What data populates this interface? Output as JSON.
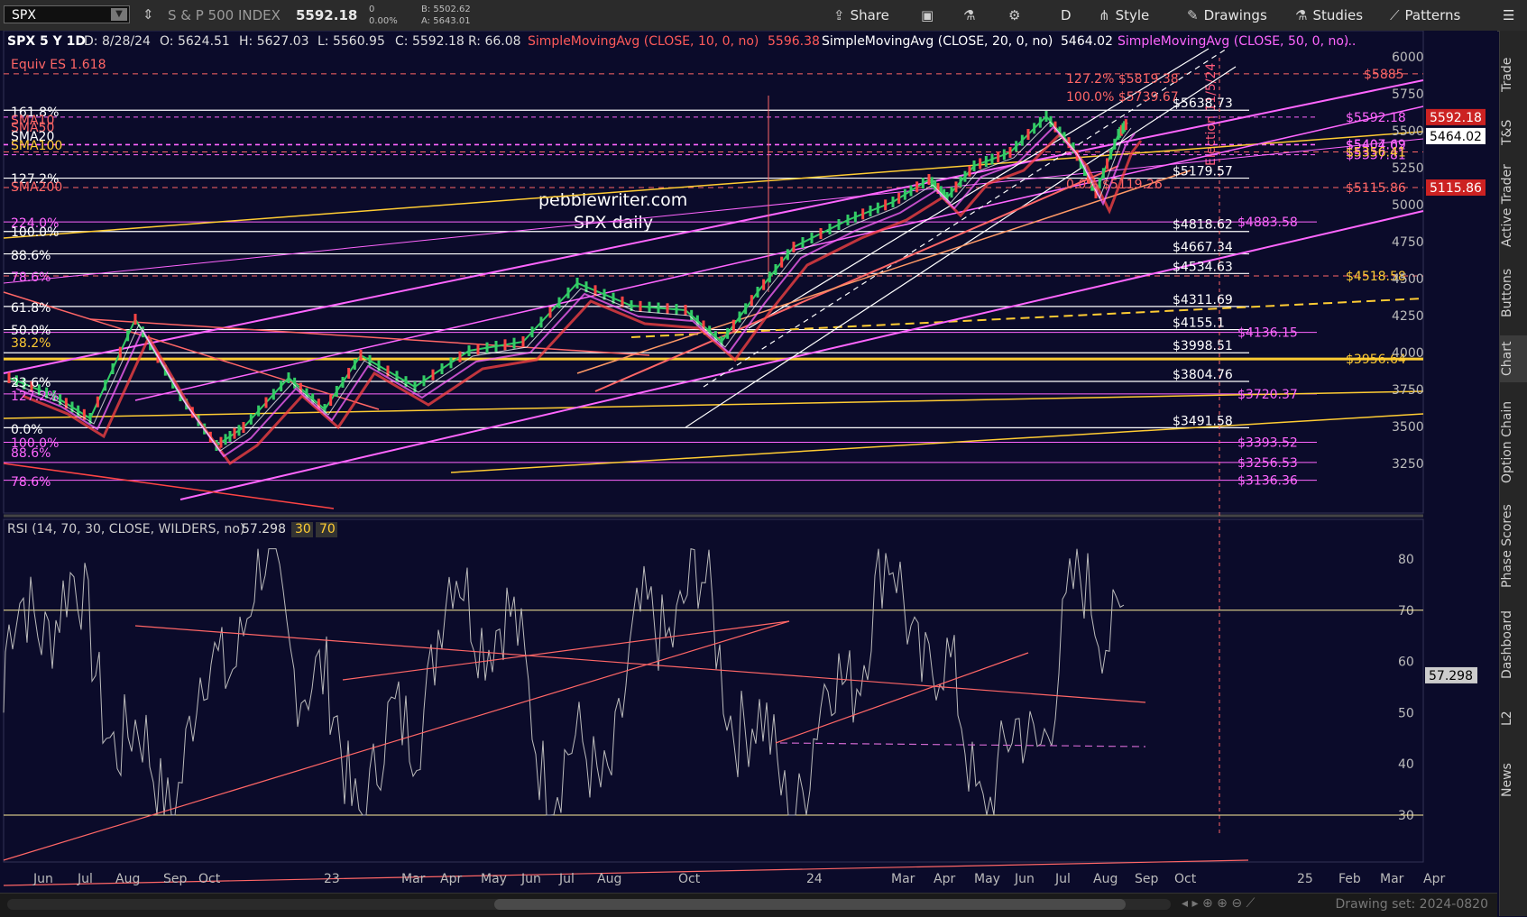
{
  "toolbar": {
    "symbol": "SPX",
    "name": "S & P 500 INDEX",
    "price": "5592.18",
    "chg": "0",
    "chg_pct": "0.00%",
    "bid": "B: 5502.62",
    "ask": "A: 5643.01",
    "share": "Share",
    "period": "D",
    "style": "Style",
    "drawings": "Drawings",
    "studies": "Studies",
    "patterns": "Patterns"
  },
  "header": {
    "title": "SPX 5 Y 1D",
    "date": "D: 8/28/24",
    "open": "O: 5624.51",
    "high": "H: 5627.03",
    "low": "L: 5560.95",
    "close": "C: 5592.18",
    "range": "R: 66.08",
    "sma10": "SimpleMovingAvg (CLOSE, 10, 0, no)",
    "sma10_val": "5596.38",
    "sma20": "SimpleMovingAvg (CLOSE, 20, 0, no)",
    "sma20_val": "5464.02",
    "sma50": "SimpleMovingAvg (CLOSE, 50, 0, no)",
    "more": "..."
  },
  "annotations": {
    "equiv": "Equiv ES 1.618",
    "site": "pebblewriter.com",
    "subtitle": "SPX daily",
    "election": "Election 11/5/24"
  },
  "fib_left": [
    "161.8%",
    "SMA10",
    "SMA50",
    "SMA20",
    "SMA100",
    "127.2%",
    "SMA200",
    "224.0%",
    "100.0%",
    "88.6%",
    "78.6%",
    "61.8%",
    "50.0%",
    "38.2%",
    "23.6%",
    "127.2%",
    "0.0%",
    "100.0%",
    "88.6%",
    "78.6%"
  ],
  "levels_white": [
    "$5638.73",
    "$5179.57",
    "$4818.62",
    "$4667.34",
    "$4534.63",
    "$4311.69",
    "$4155.1",
    "$3998.51",
    "$3804.76",
    "$3491.58"
  ],
  "levels_pink": [
    "$5592.18",
    "$5407.69",
    "$5404.02",
    "$5337.81",
    "$4883.58",
    "$4136.15",
    "$3720.37",
    "$3393.52",
    "$3256.53",
    "$3136.36"
  ],
  "levels_orange": [
    "$5885",
    "$5356.41",
    "$5115.86",
    "$4518.58",
    "$3956.64"
  ],
  "upper_fibs": [
    "127.2% $5819.38",
    "100.0% $5739.67",
    "0.0% $5119.26"
  ],
  "price_axis": [
    "6000",
    "5750",
    "5500",
    "5250",
    "5000",
    "4750",
    "4500",
    "4250",
    "4000",
    "3750",
    "3500",
    "3250"
  ],
  "price_badges": {
    "close": "5592.18",
    "sma20": "5464.02",
    "sma50": "5115.86"
  },
  "rsi": {
    "label": "RSI (14, 70, 30, CLOSE, WILDERS, no)",
    "value": "57.298",
    "ob": "70",
    "os": "30",
    "axis": [
      "80",
      "70",
      "60",
      "50",
      "40",
      "30"
    ]
  },
  "x_axis": [
    "Jun",
    "Jul",
    "Aug",
    "Sep",
    "Oct",
    "23",
    "Mar",
    "Apr",
    "May",
    "Jun",
    "Jul",
    "Aug",
    "Oct",
    "24",
    "Mar",
    "Apr",
    "May",
    "Jun",
    "Jul",
    "Aug",
    "Sep",
    "Oct",
    "25",
    "Feb",
    "Mar",
    "Apr"
  ],
  "right_nav": [
    "Trade",
    "T&S",
    "Active Trader",
    "Buttons",
    "Chart",
    "Option Chain",
    "Phase Scores",
    "Dashboard",
    "L2",
    "News"
  ],
  "status": {
    "drawing_set": "Drawing set: 2024-0820"
  },
  "colors": {
    "bg": "#0b0b2a",
    "pink": "#ff66ff",
    "orange": "#ff9966",
    "gold": "#ffcc33",
    "red": "#ff4444",
    "white": "#ffffff"
  }
}
